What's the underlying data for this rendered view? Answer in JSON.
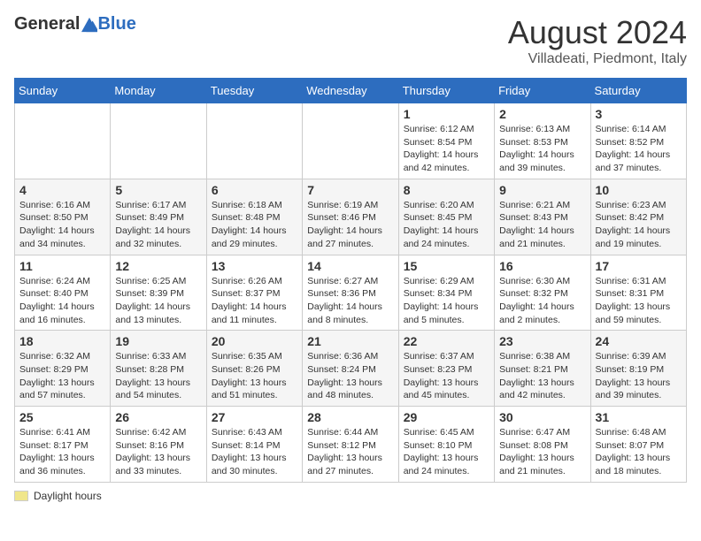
{
  "header": {
    "logo_general": "General",
    "logo_blue": "Blue",
    "month_year": "August 2024",
    "location": "Villadeati, Piedmont, Italy"
  },
  "days_of_week": [
    "Sunday",
    "Monday",
    "Tuesday",
    "Wednesday",
    "Thursday",
    "Friday",
    "Saturday"
  ],
  "weeks": [
    [
      {
        "day": "",
        "detail": ""
      },
      {
        "day": "",
        "detail": ""
      },
      {
        "day": "",
        "detail": ""
      },
      {
        "day": "",
        "detail": ""
      },
      {
        "day": "1",
        "detail": "Sunrise: 6:12 AM\nSunset: 8:54 PM\nDaylight: 14 hours\nand 42 minutes."
      },
      {
        "day": "2",
        "detail": "Sunrise: 6:13 AM\nSunset: 8:53 PM\nDaylight: 14 hours\nand 39 minutes."
      },
      {
        "day": "3",
        "detail": "Sunrise: 6:14 AM\nSunset: 8:52 PM\nDaylight: 14 hours\nand 37 minutes."
      }
    ],
    [
      {
        "day": "4",
        "detail": "Sunrise: 6:16 AM\nSunset: 8:50 PM\nDaylight: 14 hours\nand 34 minutes."
      },
      {
        "day": "5",
        "detail": "Sunrise: 6:17 AM\nSunset: 8:49 PM\nDaylight: 14 hours\nand 32 minutes."
      },
      {
        "day": "6",
        "detail": "Sunrise: 6:18 AM\nSunset: 8:48 PM\nDaylight: 14 hours\nand 29 minutes."
      },
      {
        "day": "7",
        "detail": "Sunrise: 6:19 AM\nSunset: 8:46 PM\nDaylight: 14 hours\nand 27 minutes."
      },
      {
        "day": "8",
        "detail": "Sunrise: 6:20 AM\nSunset: 8:45 PM\nDaylight: 14 hours\nand 24 minutes."
      },
      {
        "day": "9",
        "detail": "Sunrise: 6:21 AM\nSunset: 8:43 PM\nDaylight: 14 hours\nand 21 minutes."
      },
      {
        "day": "10",
        "detail": "Sunrise: 6:23 AM\nSunset: 8:42 PM\nDaylight: 14 hours\nand 19 minutes."
      }
    ],
    [
      {
        "day": "11",
        "detail": "Sunrise: 6:24 AM\nSunset: 8:40 PM\nDaylight: 14 hours\nand 16 minutes."
      },
      {
        "day": "12",
        "detail": "Sunrise: 6:25 AM\nSunset: 8:39 PM\nDaylight: 14 hours\nand 13 minutes."
      },
      {
        "day": "13",
        "detail": "Sunrise: 6:26 AM\nSunset: 8:37 PM\nDaylight: 14 hours\nand 11 minutes."
      },
      {
        "day": "14",
        "detail": "Sunrise: 6:27 AM\nSunset: 8:36 PM\nDaylight: 14 hours\nand 8 minutes."
      },
      {
        "day": "15",
        "detail": "Sunrise: 6:29 AM\nSunset: 8:34 PM\nDaylight: 14 hours\nand 5 minutes."
      },
      {
        "day": "16",
        "detail": "Sunrise: 6:30 AM\nSunset: 8:32 PM\nDaylight: 14 hours\nand 2 minutes."
      },
      {
        "day": "17",
        "detail": "Sunrise: 6:31 AM\nSunset: 8:31 PM\nDaylight: 13 hours\nand 59 minutes."
      }
    ],
    [
      {
        "day": "18",
        "detail": "Sunrise: 6:32 AM\nSunset: 8:29 PM\nDaylight: 13 hours\nand 57 minutes."
      },
      {
        "day": "19",
        "detail": "Sunrise: 6:33 AM\nSunset: 8:28 PM\nDaylight: 13 hours\nand 54 minutes."
      },
      {
        "day": "20",
        "detail": "Sunrise: 6:35 AM\nSunset: 8:26 PM\nDaylight: 13 hours\nand 51 minutes."
      },
      {
        "day": "21",
        "detail": "Sunrise: 6:36 AM\nSunset: 8:24 PM\nDaylight: 13 hours\nand 48 minutes."
      },
      {
        "day": "22",
        "detail": "Sunrise: 6:37 AM\nSunset: 8:23 PM\nDaylight: 13 hours\nand 45 minutes."
      },
      {
        "day": "23",
        "detail": "Sunrise: 6:38 AM\nSunset: 8:21 PM\nDaylight: 13 hours\nand 42 minutes."
      },
      {
        "day": "24",
        "detail": "Sunrise: 6:39 AM\nSunset: 8:19 PM\nDaylight: 13 hours\nand 39 minutes."
      }
    ],
    [
      {
        "day": "25",
        "detail": "Sunrise: 6:41 AM\nSunset: 8:17 PM\nDaylight: 13 hours\nand 36 minutes."
      },
      {
        "day": "26",
        "detail": "Sunrise: 6:42 AM\nSunset: 8:16 PM\nDaylight: 13 hours\nand 33 minutes."
      },
      {
        "day": "27",
        "detail": "Sunrise: 6:43 AM\nSunset: 8:14 PM\nDaylight: 13 hours\nand 30 minutes."
      },
      {
        "day": "28",
        "detail": "Sunrise: 6:44 AM\nSunset: 8:12 PM\nDaylight: 13 hours\nand 27 minutes."
      },
      {
        "day": "29",
        "detail": "Sunrise: 6:45 AM\nSunset: 8:10 PM\nDaylight: 13 hours\nand 24 minutes."
      },
      {
        "day": "30",
        "detail": "Sunrise: 6:47 AM\nSunset: 8:08 PM\nDaylight: 13 hours\nand 21 minutes."
      },
      {
        "day": "31",
        "detail": "Sunrise: 6:48 AM\nSunset: 8:07 PM\nDaylight: 13 hours\nand 18 minutes."
      }
    ]
  ],
  "legend": {
    "label": "Daylight hours"
  }
}
